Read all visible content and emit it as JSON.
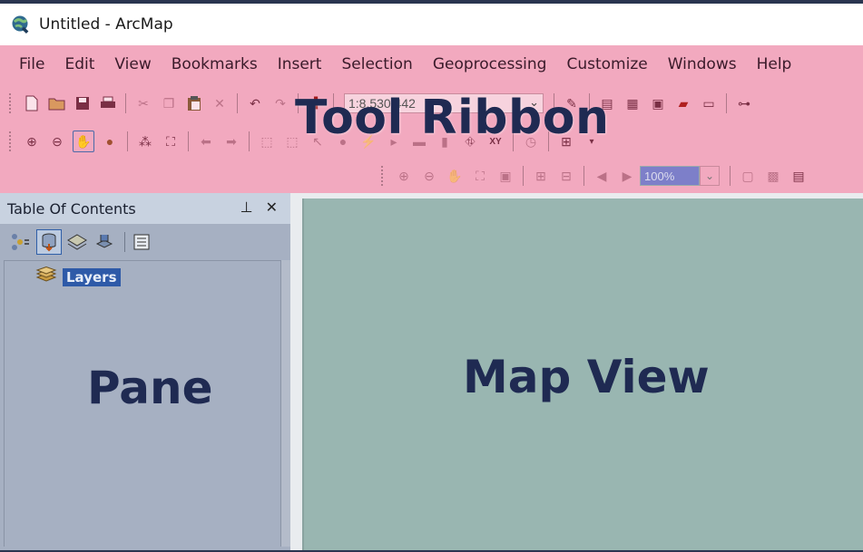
{
  "window": {
    "title": "Untitled - ArcMap",
    "app_icon": "arcmap-globe-icon"
  },
  "menu": [
    "File",
    "Edit",
    "View",
    "Bookmarks",
    "Insert",
    "Selection",
    "Geoprocessing",
    "Customize",
    "Windows",
    "Help"
  ],
  "toolbar": {
    "scale_value": "1:8,530,442",
    "zoom_value": "100%"
  },
  "ribbon": {
    "label": "Tool Ribbon",
    "color": "#f2a9bf"
  },
  "pane": {
    "title": "Table Of Contents",
    "pin_icon": "pin-icon",
    "close_icon": "close-icon",
    "tree_root": "Layers",
    "label": "Pane",
    "color": "#a6b0c2"
  },
  "map": {
    "label": "Map View",
    "color": "#99b6b1"
  }
}
